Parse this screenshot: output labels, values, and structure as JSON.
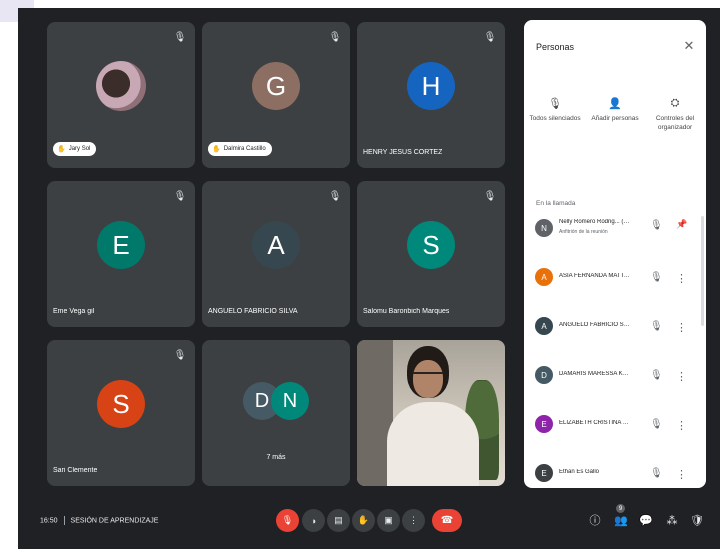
{
  "tiles": [
    {
      "type": "avatar_photo",
      "name": "Jary Sol",
      "hand_raised": true
    },
    {
      "type": "avatar",
      "initial": "G",
      "color": "#8d6e63",
      "name": "Dalmira Castillo",
      "hand_raised": true
    },
    {
      "type": "avatar",
      "initial": "H",
      "color": "#1565c0",
      "name": "HENRY JESUS CORTEZ"
    },
    {
      "type": "avatar",
      "initial": "E",
      "color": "#00796b",
      "name": "Eme Vega gil"
    },
    {
      "type": "avatar",
      "initial": "A",
      "color": "#37474f",
      "name": "ANGUELO FABRICIO SILVA"
    },
    {
      "type": "avatar",
      "initial": "S",
      "color": "#00897b",
      "name": "Salomu Baronbich Marques"
    },
    {
      "type": "avatar",
      "initial": "S",
      "color": "#d84315",
      "name": "Sari Clemente"
    },
    {
      "type": "more",
      "initials": [
        "D",
        "N"
      ],
      "colors": [
        "#455a64",
        "#00897b"
      ],
      "label": "7 más"
    },
    {
      "type": "video"
    }
  ],
  "people_panel": {
    "title": "Personas",
    "actions": [
      {
        "icon": "mic-off-icon",
        "label": "Todos silenciados"
      },
      {
        "icon": "add-person-icon",
        "label": "Añadir personas"
      },
      {
        "icon": "host-controls-icon",
        "label": "Controles del organizador"
      }
    ],
    "section_title": "En la llamada",
    "participants": [
      {
        "initial": "N",
        "color": "#5f6368",
        "name": "Nelly Romero Rodrig... (Tú)",
        "role": "Anfitrión de la reunión",
        "trailing": "pin"
      },
      {
        "initial": "A",
        "color": "#e8710a",
        "name": "ASIA FERNANDA MATTA...",
        "trailing": "menu"
      },
      {
        "initial": "A",
        "color": "#37474f",
        "name": "ANGUELO FABRICIO SILVA",
        "trailing": "menu"
      },
      {
        "initial": "D",
        "color": "#455a64",
        "name": "DAMARIS MARESSA KRYS...",
        "trailing": "menu"
      },
      {
        "initial": "E",
        "color": "#8e24aa",
        "name": "ELIZABETH CRISTINA DEL...",
        "trailing": "menu"
      },
      {
        "initial": "E",
        "color": "#3c4043",
        "name": "Ethan Es Gallo",
        "trailing": "menu"
      }
    ]
  },
  "meeting": {
    "time": "16:50",
    "name": "SESIÓN DE APRENDIZAJE"
  },
  "controls": [
    {
      "name": "mic-off-icon",
      "glyph": "🎙",
      "red": true
    },
    {
      "name": "camera-icon",
      "glyph": "◑"
    },
    {
      "name": "captions-icon",
      "glyph": "▤"
    },
    {
      "name": "raise-hand-icon",
      "glyph": "✋"
    },
    {
      "name": "present-icon",
      "glyph": "▣"
    },
    {
      "name": "more-options-icon",
      "glyph": "⋮"
    }
  ],
  "right_controls": [
    {
      "name": "info-icon",
      "glyph": "ⓘ"
    },
    {
      "name": "people-icon",
      "glyph": "👥",
      "badge": "9",
      "active": true
    },
    {
      "name": "chat-icon",
      "glyph": "💬"
    },
    {
      "name": "activities-icon",
      "glyph": "⁂"
    },
    {
      "name": "lock-icon",
      "glyph": "🛡"
    }
  ]
}
